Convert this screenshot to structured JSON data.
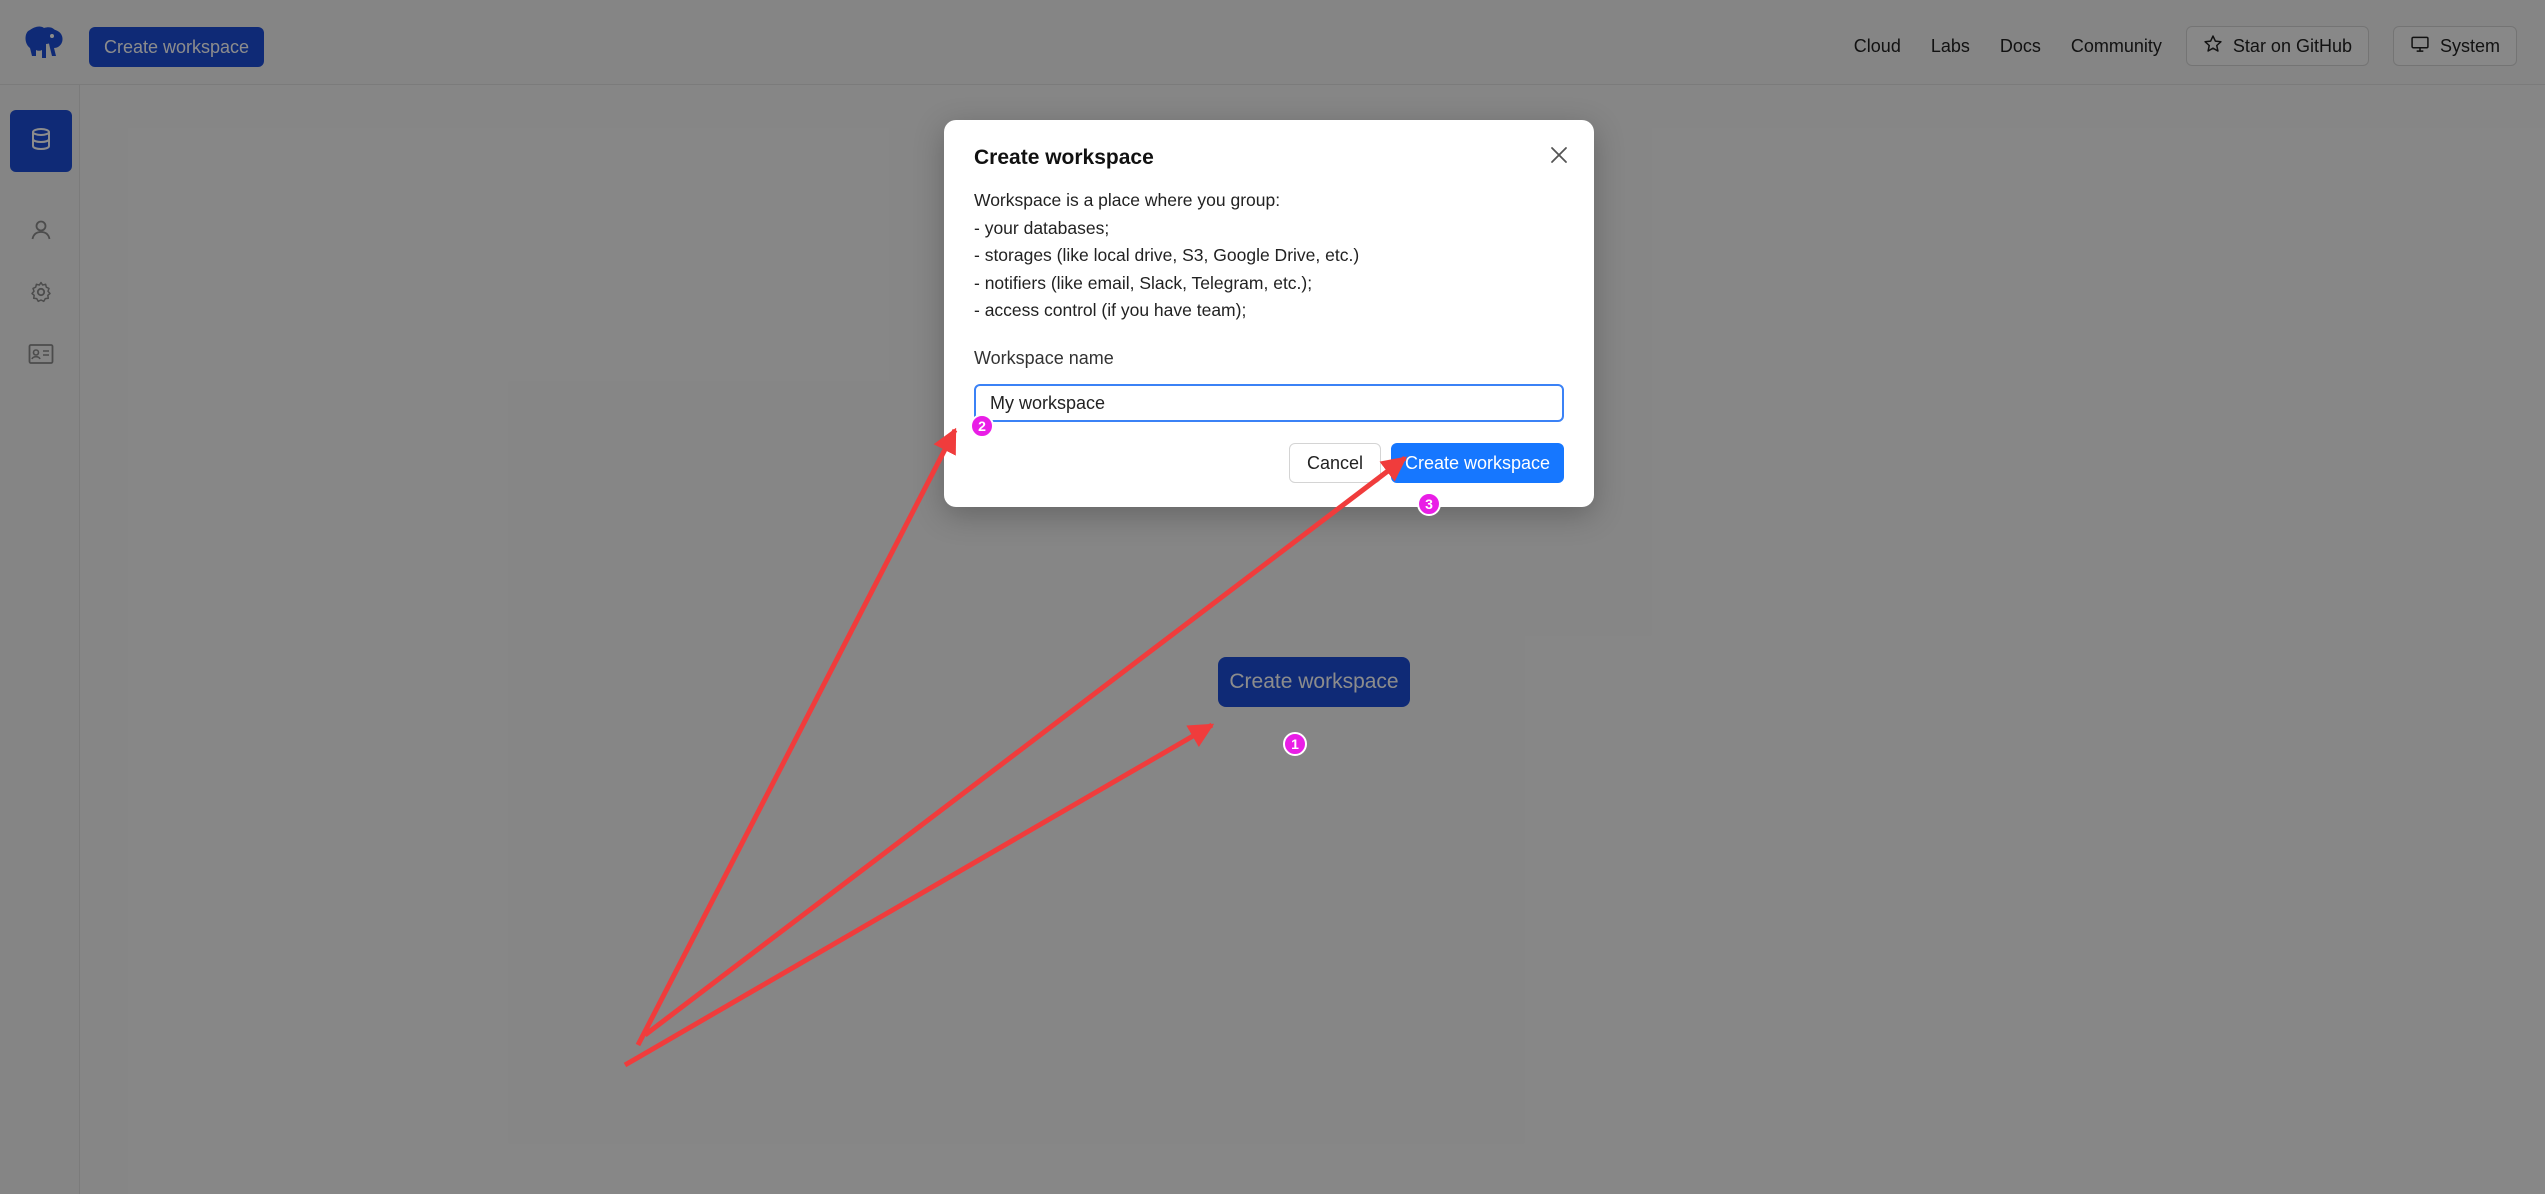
{
  "topbar": {
    "create_workspace_label": "Create workspace",
    "nav": {
      "cloud": "Cloud",
      "labs": "Labs",
      "docs": "Docs",
      "community": "Community",
      "star_github": "Star on GitHub",
      "system": "System"
    }
  },
  "main": {
    "create_workspace_label": "Create workspace"
  },
  "modal": {
    "title": "Create workspace",
    "description": [
      "Workspace is a place where you group:",
      "- your databases;",
      "- storages (like local drive, S3, Google Drive, etc.)",
      "- notifiers (like email, Slack, Telegram, etc.);",
      "- access control (if you have team);"
    ],
    "field_label": "Workspace name",
    "field_value": "My workspace",
    "cancel_label": "Cancel",
    "submit_label": "Create workspace"
  },
  "annotations": {
    "step1": "1",
    "step2": "2",
    "step3": "3"
  },
  "colors": {
    "primary": "#1d4ed8",
    "modal_primary": "#1677ff",
    "annotation_arrow": "#f03c3c",
    "annotation_marker": "#e91ee6"
  },
  "icons": {
    "logo": "elephant-logo-icon",
    "database": "database-icon",
    "user": "user-icon",
    "settings": "gear-icon",
    "id_card": "id-card-icon",
    "star": "star-icon",
    "monitor": "monitor-icon",
    "close": "close-icon"
  }
}
